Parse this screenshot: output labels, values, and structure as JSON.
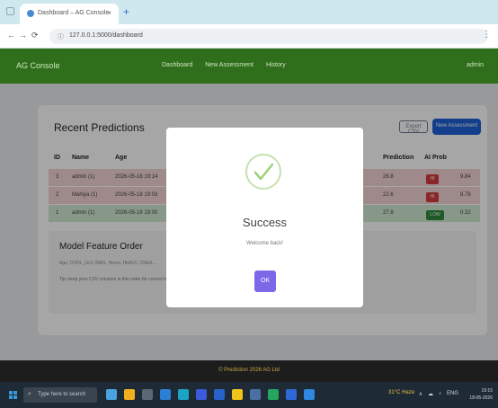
{
  "browser": {
    "tab_title": "Dashboard – AG Console",
    "close_glyph": "×",
    "new_tab_glyph": "+",
    "back_glyph": "←",
    "forward_glyph": "→",
    "reload_glyph": "⟳",
    "site_info_glyph": "ⓘ",
    "menu_glyph": "⋮",
    "url": "127.0.0.1:5000/dashboard"
  },
  "navbar": {
    "brand": "AG Console",
    "links": [
      "Dashboard",
      "New Assessment",
      "History"
    ],
    "user": "admin",
    "bg_color": "#2f6e1a"
  },
  "predictions": {
    "title": "Recent Predictions",
    "export_label": "Export CSV",
    "new_label": "New Assessment",
    "columns": [
      "ID",
      "Name",
      "Age",
      "",
      "Prediction",
      "AI Prob",
      ""
    ],
    "rows": [
      {
        "id": "3",
        "name": "admin (1)",
        "date": "2026-05-18 19:14",
        "prediction": "26.8",
        "badge": "HI",
        "prob": "9.84",
        "status": "danger"
      },
      {
        "id": "2",
        "name": "Mahiya (1)",
        "date": "2026-05-18 19:03",
        "prediction": "22.6",
        "badge": "HI",
        "prob": "8.78",
        "status": "danger"
      },
      {
        "id": "1",
        "name": "admin (1)",
        "date": "2026-05-18 19:00",
        "prediction": "27.8",
        "badge": "LOW",
        "prob": "0.32",
        "status": "success"
      }
    ]
  },
  "features": {
    "title": "Model Feature Order",
    "list": "Age, CHOL_LEV, BMI1, Hemo, HbA1C, CREA ...",
    "tip": "Tip: keep your CSV columns in this order for correct batch predictions."
  },
  "modal": {
    "title": "Success",
    "message": "Welcome back!",
    "ok_label": "OK",
    "accent_color": "#7d68e8"
  },
  "footer": {
    "text": "© Prediction 2026 AG Ltd"
  },
  "taskbar": {
    "search_placeholder": "Type here to search",
    "search_glyph": "⌕",
    "weather": "31°C Haze",
    "tray_glyphs": [
      "∧",
      "☁",
      "♪",
      "ENG"
    ],
    "time": "19:15",
    "date": "18-05-2026"
  }
}
